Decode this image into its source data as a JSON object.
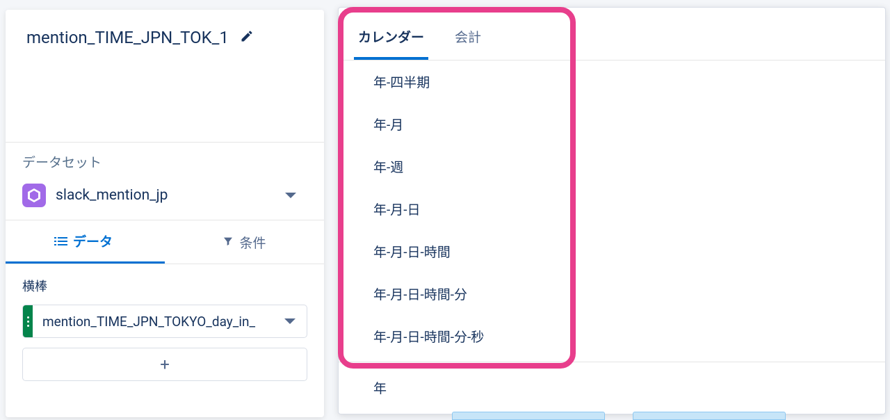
{
  "leftPanel": {
    "title": "mention_TIME_JPN_TOK_1",
    "datasetSectionLabel": "データセット",
    "datasetName": "slack_mention_jp",
    "tabs": {
      "data": "データ",
      "filter": "条件"
    },
    "fieldGroupLabel": "横棒",
    "fieldPillText": "mention_TIME_JPN_TOKYO_day_in_",
    "addLabel": "+"
  },
  "dropdown": {
    "tabs": {
      "calendar": "カレンダー",
      "fiscal": "会計"
    },
    "itemsGroup1": [
      "年-四半期",
      "年-月",
      "年-週",
      "年-月-日",
      "年-月-日-時間",
      "年-月-日-時間-分",
      "年-月-日-時間-分-秒"
    ],
    "itemsGroup2": [
      "年"
    ]
  }
}
